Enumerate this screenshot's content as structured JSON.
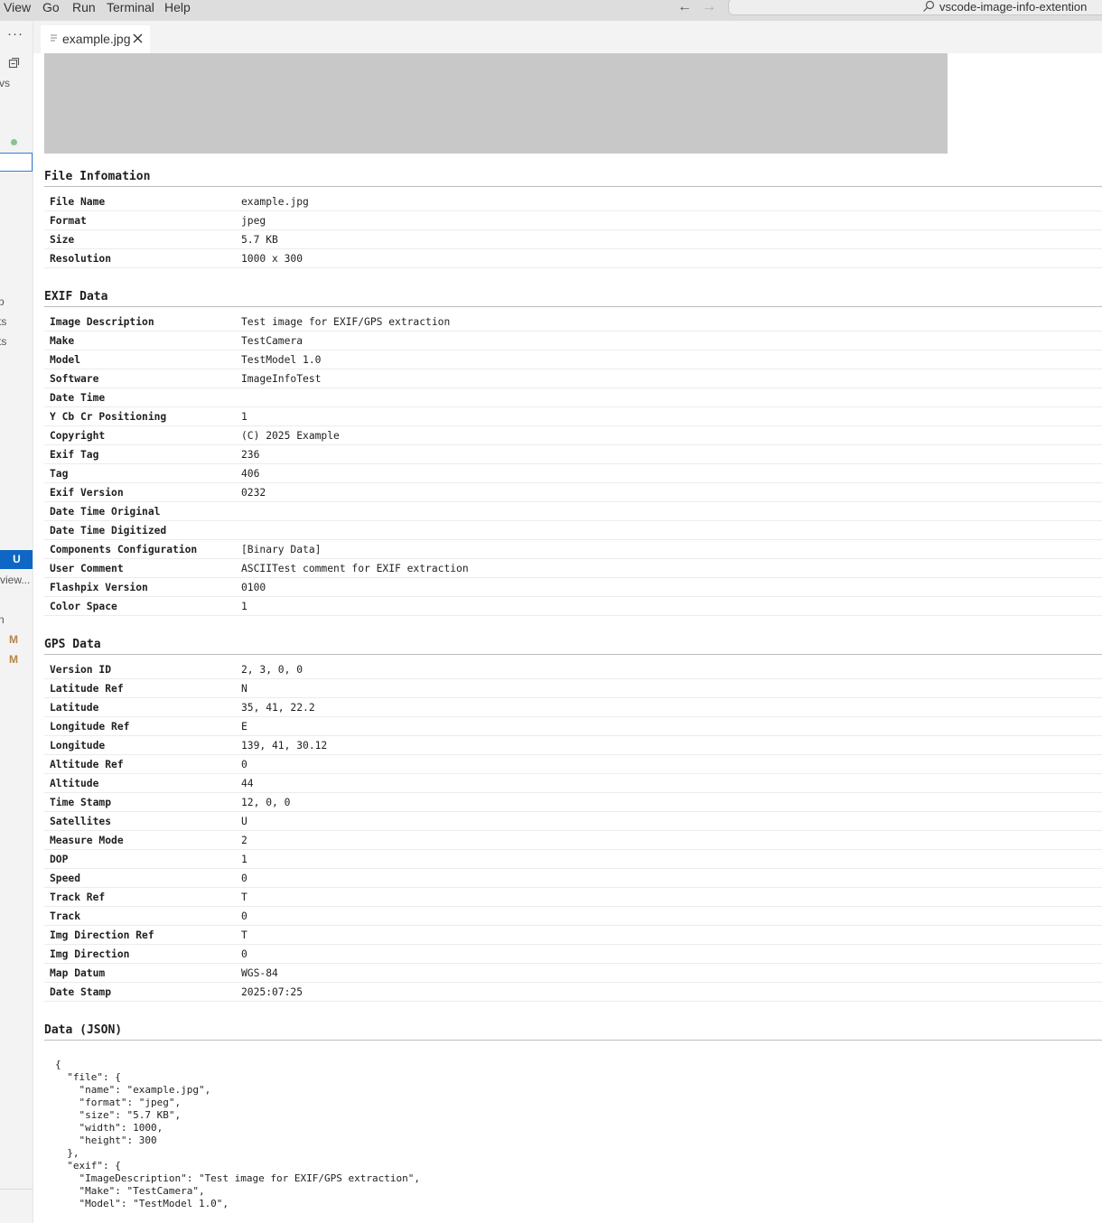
{
  "menu": [
    "View",
    "Go",
    "Run",
    "Terminal",
    "Help"
  ],
  "command_center": "vscode-image-info-extention",
  "left_strip": {
    "fragments": [
      "vs",
      "p",
      "ts",
      "ts",
      "view...",
      "n"
    ],
    "badge": "U",
    "mod_marks": [
      "M",
      "M"
    ]
  },
  "tab": {
    "label": "example.jpg"
  },
  "sections": {
    "file_title": "File Infomation",
    "exif_title": "EXIF Data",
    "gps_title": "GPS Data",
    "json_title": "Data (JSON)"
  },
  "file_info": [
    {
      "k": "File Name",
      "v": "example.jpg"
    },
    {
      "k": "Format",
      "v": "jpeg"
    },
    {
      "k": "Size",
      "v": "5.7 KB"
    },
    {
      "k": "Resolution",
      "v": "1000 x 300"
    }
  ],
  "exif": [
    {
      "k": "Image Description",
      "v": "Test image for EXIF/GPS extraction"
    },
    {
      "k": "Make",
      "v": "TestCamera"
    },
    {
      "k": "Model",
      "v": "TestModel 1.0"
    },
    {
      "k": "Software",
      "v": "ImageInfoTest"
    },
    {
      "k": "Date Time",
      "v": ""
    },
    {
      "k": "Y Cb Cr Positioning",
      "v": "1"
    },
    {
      "k": "Copyright",
      "v": "(C) 2025 Example"
    },
    {
      "k": "Exif Tag",
      "v": "236"
    },
    {
      "k": "Tag",
      "v": "406"
    },
    {
      "k": "Exif Version",
      "v": "0232"
    },
    {
      "k": "Date Time Original",
      "v": ""
    },
    {
      "k": "Date Time Digitized",
      "v": ""
    },
    {
      "k": "Components Configuration",
      "v": "[Binary Data]"
    },
    {
      "k": "User Comment",
      "v": "ASCIITest comment for EXIF extraction"
    },
    {
      "k": "Flashpix Version",
      "v": "0100"
    },
    {
      "k": "Color Space",
      "v": "1"
    }
  ],
  "gps": [
    {
      "k": "Version ID",
      "v": "2, 3, 0, 0"
    },
    {
      "k": "Latitude Ref",
      "v": "N"
    },
    {
      "k": "Latitude",
      "v": "35, 41, 22.2"
    },
    {
      "k": "Longitude Ref",
      "v": "E"
    },
    {
      "k": "Longitude",
      "v": "139, 41, 30.12"
    },
    {
      "k": "Altitude Ref",
      "v": "0"
    },
    {
      "k": "Altitude",
      "v": "44"
    },
    {
      "k": "Time Stamp",
      "v": "12, 0, 0"
    },
    {
      "k": "Satellites",
      "v": "U"
    },
    {
      "k": "Measure Mode",
      "v": "2"
    },
    {
      "k": "DOP",
      "v": "1"
    },
    {
      "k": "Speed",
      "v": "0"
    },
    {
      "k": "Track Ref",
      "v": "T"
    },
    {
      "k": "Track",
      "v": "0"
    },
    {
      "k": "Img Direction Ref",
      "v": "T"
    },
    {
      "k": "Img Direction",
      "v": "0"
    },
    {
      "k": "Map Datum",
      "v": "WGS-84"
    },
    {
      "k": "Date Stamp",
      "v": "2025:07:25"
    }
  ],
  "json_text": "{\n  \"file\": {\n    \"name\": \"example.jpg\",\n    \"format\": \"jpeg\",\n    \"size\": \"5.7 KB\",\n    \"width\": 1000,\n    \"height\": 300\n  },\n  \"exif\": {\n    \"ImageDescription\": \"Test image for EXIF/GPS extraction\",\n    \"Make\": \"TestCamera\",\n    \"Model\": \"TestModel 1.0\","
}
